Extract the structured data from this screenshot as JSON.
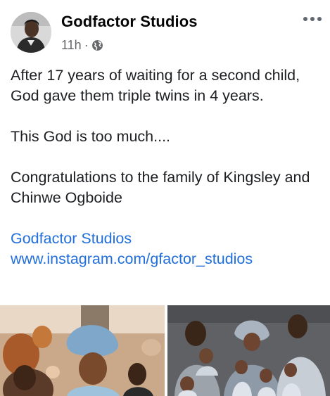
{
  "post": {
    "author": "Godfactor Studios",
    "time": "11h",
    "separator": "·",
    "privacy_icon": "globe-icon",
    "more_icon": "more-options-icon",
    "paragraph1": "After 17 years of waiting for a second child, God gave them triple twins in 4 years.",
    "paragraph2": "This God is too much....",
    "paragraph3": "Congratulations to the family of Kingsley and Chinwe Ogboide",
    "link1": "Godfactor Studios",
    "link2": "www.instagram.com/gfactor_studios"
  },
  "colors": {
    "link": "#216fdb",
    "meta": "#65676b",
    "text": "#1c1e21"
  }
}
